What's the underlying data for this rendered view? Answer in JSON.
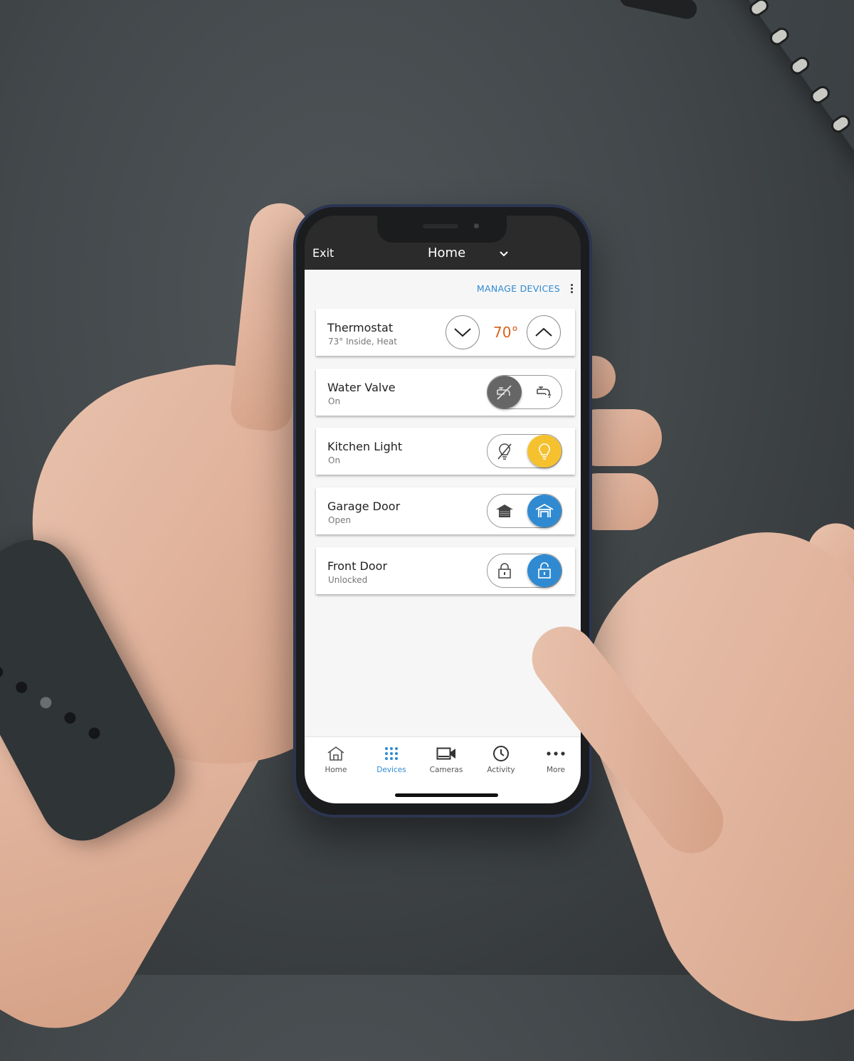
{
  "app": {
    "header": {
      "exit_label": "Exit",
      "title": "Home",
      "title_icon": "chevron-down-icon"
    },
    "toolbar": {
      "manage_devices_label": "MANAGE DEVICES",
      "overflow_icon": "kebab-menu-icon"
    },
    "devices": [
      {
        "name": "Thermostat",
        "status": "73° Inside, Heat",
        "control": "stepper",
        "setpoint": "70°",
        "decrease_icon": "chevron-down-icon",
        "increase_icon": "chevron-up-icon",
        "setpoint_color": "#d9641e"
      },
      {
        "name": "Water Valve",
        "status": "On",
        "control": "toggle",
        "off_icon": "water-off-icon",
        "on_icon": "faucet-icon",
        "active_segment": "off",
        "active_color": "#666666"
      },
      {
        "name": "Kitchen Light",
        "status": "On",
        "control": "toggle",
        "off_icon": "light-off-icon",
        "on_icon": "light-bulb-icon",
        "active_segment": "on",
        "active_color": "#f5c12e"
      },
      {
        "name": "Garage Door",
        "status": "Open",
        "control": "toggle",
        "off_icon": "garage-closed-icon",
        "on_icon": "garage-open-icon",
        "active_segment": "on",
        "active_color": "#2f8ad1"
      },
      {
        "name": "Front Door",
        "status": "Unlocked",
        "control": "toggle",
        "off_icon": "lock-closed-icon",
        "on_icon": "lock-open-icon",
        "active_segment": "on",
        "active_color": "#2f8ad1"
      }
    ],
    "tabs": [
      {
        "label": "Home",
        "icon": "home-icon",
        "active": false
      },
      {
        "label": "Devices",
        "icon": "devices-grid-icon",
        "active": true
      },
      {
        "label": "Cameras",
        "icon": "camera-icon",
        "active": false
      },
      {
        "label": "Activity",
        "icon": "clock-icon",
        "active": false
      },
      {
        "label": "More",
        "icon": "more-dots-icon",
        "active": false
      }
    ],
    "colors": {
      "accent": "#2f8ad1",
      "header_bg": "#2b2b2b",
      "content_bg": "#f6f6f6",
      "light_on": "#f5c12e",
      "setpoint": "#d9641e"
    }
  }
}
